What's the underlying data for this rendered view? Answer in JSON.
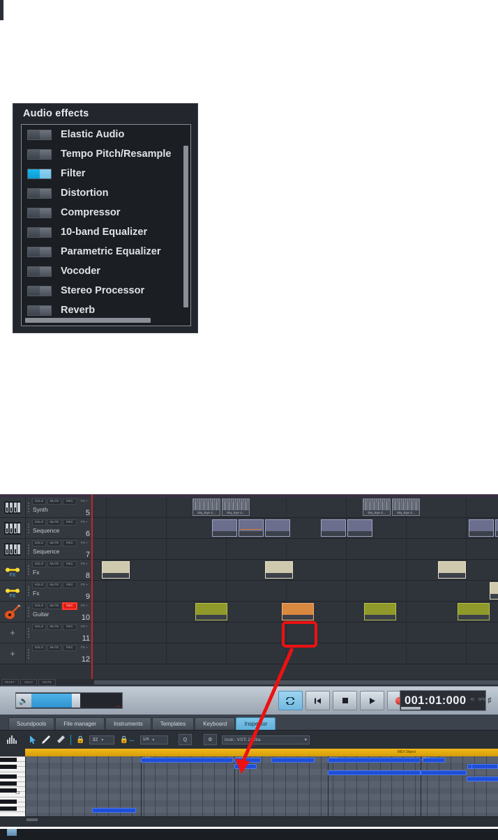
{
  "audio_effects_panel": {
    "title": "Audio effects",
    "items": [
      {
        "label": "Elastic Audio",
        "enabled": false
      },
      {
        "label": "Tempo Pitch/Resample",
        "enabled": false
      },
      {
        "label": "Filter",
        "enabled": true
      },
      {
        "label": "Distortion",
        "enabled": false
      },
      {
        "label": "Compressor",
        "enabled": false
      },
      {
        "label": "10-band Equalizer",
        "enabled": false
      },
      {
        "label": "Parametric Equalizer",
        "enabled": false
      },
      {
        "label": "Vocoder",
        "enabled": false
      },
      {
        "label": "Stereo Processor",
        "enabled": false
      },
      {
        "label": "Reverb",
        "enabled": false
      }
    ],
    "accent_color": "#19b8ee"
  },
  "arrangement": {
    "button_labels": {
      "solo": "SOLO",
      "mute": "MUTE",
      "rec": "REC",
      "fx": "FX ~"
    },
    "reset_label": "RESET:",
    "tracks": [
      {
        "name": "Synth",
        "number": "5",
        "icon": "synth-icon",
        "rec_active": false
      },
      {
        "name": "Sequence",
        "number": "6",
        "icon": "synth-icon",
        "rec_active": false
      },
      {
        "name": "Sequence",
        "number": "7",
        "icon": "synth-icon",
        "rec_active": false
      },
      {
        "name": "Fx",
        "number": "8",
        "icon": "fx-icon",
        "rec_active": false
      },
      {
        "name": "Fx",
        "number": "9",
        "icon": "fx-icon",
        "rec_active": false
      },
      {
        "name": "Guitar",
        "number": "10",
        "icon": "guitar-icon",
        "rec_active": true
      },
      {
        "name": "",
        "number": "11",
        "icon": "add-track-icon",
        "rec_active": false
      },
      {
        "name": "",
        "number": "12",
        "icon": "add-track-icon",
        "rec_active": false
      }
    ],
    "clip_label": "Dry_Eye 2..."
  },
  "transport": {
    "loop_icon": "loop-icon",
    "rewind_icon": "rewind-icon",
    "stop_icon": "stop-icon",
    "play_icon": "play-icon",
    "record_icon": "record-icon",
    "timecode": "001:01:000",
    "timecode_sub_left": "40",
    "timecode_sub_right": "BPM",
    "metronome_icon": "metronome-icon",
    "volume_icon": "speaker-icon"
  },
  "tabs": [
    {
      "label": "Soundpools",
      "selected": false
    },
    {
      "label": "File manager",
      "selected": false
    },
    {
      "label": "Instruments",
      "selected": false
    },
    {
      "label": "Templates",
      "selected": false
    },
    {
      "label": "Keyboard",
      "selected": false
    },
    {
      "label": "Inspector",
      "selected": true
    }
  ],
  "midi_toolbar": {
    "levels_icon": "levels-icon",
    "arrow_tool_icon": "arrow-tool-icon",
    "draw_tool_icon": "pencil-tool-icon",
    "erase_tool_icon": "eraser-tool-icon",
    "grid_lock_icon": "lock-icon",
    "grid_value": "32",
    "length_lock_icon": "lock-arrows-icon",
    "length_value": "1/4",
    "quantize_label": "Q",
    "settings_icon": "gear-icon",
    "instrument_label": "Instr.: VSTi 2: Vita"
  },
  "piano_roll": {
    "header_label": "MIDI Object",
    "bar_labels": [
      "1/9/2",
      "1/9/3",
      "1/9/4",
      "2/0/1",
      "2/0/2"
    ],
    "c_key_label": "C3",
    "note_color": "#1e4fd8"
  },
  "annotation": {
    "arrow_color": "#ee1111",
    "highlight_color": "#ee1111"
  }
}
